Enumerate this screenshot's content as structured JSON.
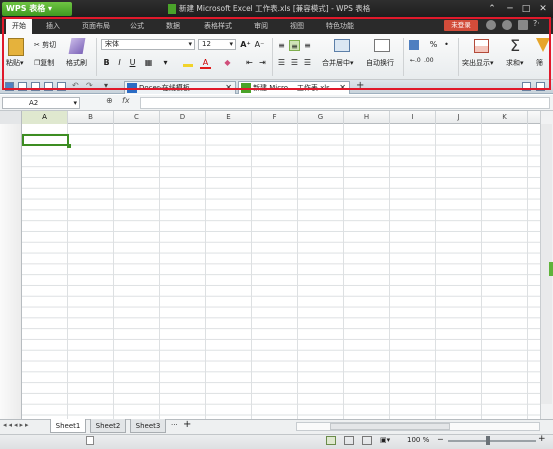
{
  "titlebar": {
    "app_label": "WPS 表格",
    "title": "新建 Microsoft Excel 工作表.xls [兼容模式] - WPS 表格",
    "controls": [
      "⌃",
      "─",
      "□",
      "✕"
    ]
  },
  "menu_tabs": [
    "开始",
    "插入",
    "页面布局",
    "公式",
    "数据",
    "表格样式",
    "审阅",
    "视图",
    "特色功能"
  ],
  "login_label": "未登录",
  "ribbon": {
    "paste": "粘贴",
    "cut": "剪切",
    "copy": "复制",
    "format_painter": "格式刷",
    "font_name": "宋体",
    "font_size": "12",
    "bold": "B",
    "italic": "I",
    "underline": "U",
    "font_grow": "A⁺",
    "font_shrink": "A⁻",
    "merge_center": "合并居中",
    "wrap_text": "自动换行",
    "number_percent": "%",
    "conditional_format": "突出显示",
    "sum": "求和",
    "sum_symbol": "Σ",
    "filter": "筛"
  },
  "doc_tabs": [
    {
      "label": "Docer-在线模板",
      "active": false
    },
    {
      "label": "新建 Micro... 工作表.xls",
      "active": true
    }
  ],
  "add_tab": "+",
  "formula_bar": {
    "name_box": "A2",
    "fx": "fx",
    "zoom_icon": "⊕",
    "value": ""
  },
  "columns": [
    "A",
    "B",
    "C",
    "D",
    "E",
    "F",
    "G",
    "H",
    "I",
    "J",
    "K"
  ],
  "rows": [
    "1",
    "2",
    "3",
    "4",
    "5",
    "6",
    "7",
    "8",
    "9",
    "10",
    "11",
    "12",
    "13",
    "14",
    "15",
    "16",
    "17",
    "18",
    "19",
    "20",
    "21",
    "22",
    "23",
    "24",
    "25"
  ],
  "active_cell": {
    "column": "A",
    "row": "2"
  },
  "sheets": [
    "Sheet1",
    "Sheet2",
    "Sheet3"
  ],
  "sheet_more": "···",
  "add_sheet": "+",
  "status": {
    "zoom": "100 %",
    "zoom_out": "─",
    "zoom_in": "+"
  },
  "colors": {
    "accent_green": "#4aa32a",
    "highlight_red": "#e0192b",
    "login_red": "#d24c3a"
  }
}
